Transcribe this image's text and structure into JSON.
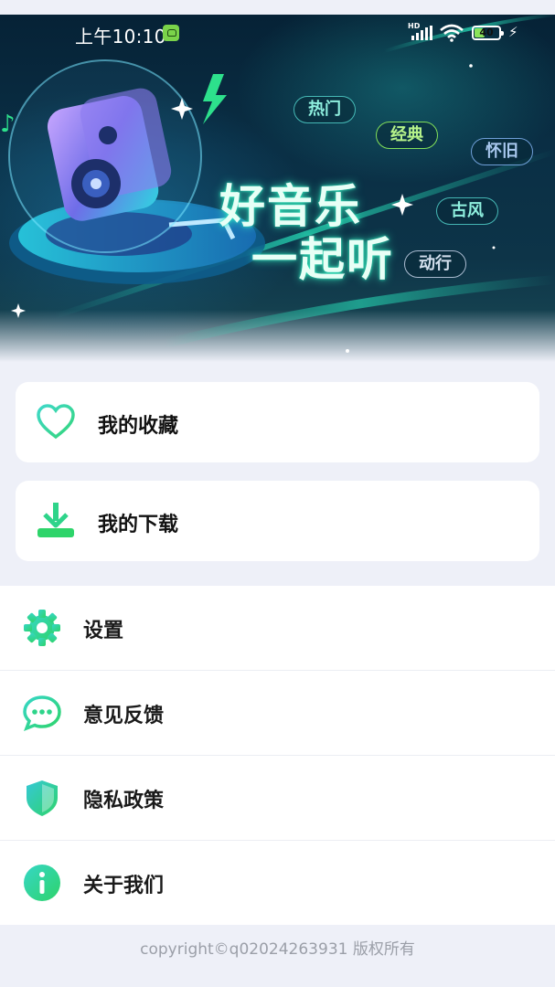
{
  "status_bar": {
    "time": "上午10:10",
    "network": "HD",
    "battery": "40"
  },
  "banner": {
    "title_line1": "好音乐",
    "title_line2": "一起听",
    "tags": [
      "热门",
      "经典",
      "怀旧",
      "古风",
      "动行"
    ]
  },
  "cards": [
    {
      "label": "我的收藏",
      "icon": "heart-icon"
    },
    {
      "label": "我的下载",
      "icon": "download-icon"
    }
  ],
  "menu": [
    {
      "label": "设置",
      "icon": "gear-icon"
    },
    {
      "label": "意见反馈",
      "icon": "chat-icon"
    },
    {
      "label": "隐私政策",
      "icon": "shield-icon"
    },
    {
      "label": "关于我们",
      "icon": "info-icon"
    }
  ],
  "footer": {
    "copyright": "copyright©q02024263931 版权所有"
  },
  "colors": {
    "accent_green": "#2ed48a",
    "accent_teal": "#2bd3c6",
    "background": "#eef0f8"
  }
}
